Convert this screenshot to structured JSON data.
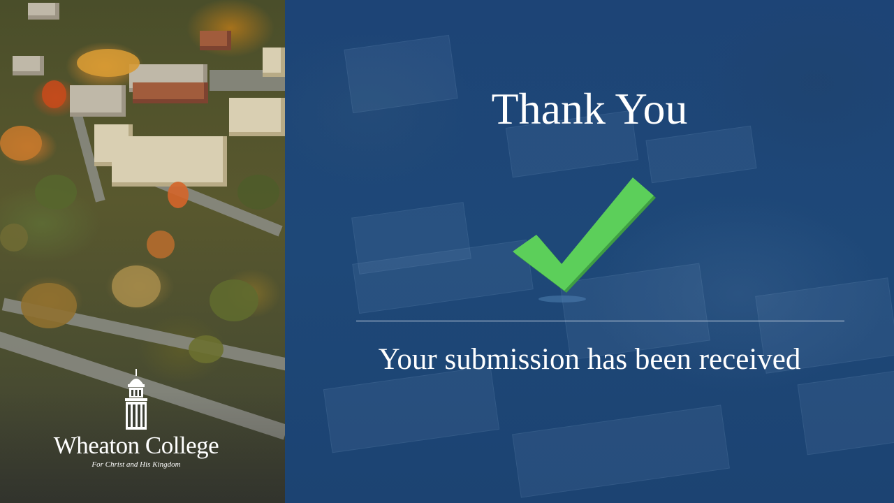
{
  "slide": {
    "title": "Thank You",
    "message": "Your submission has been received"
  },
  "logo": {
    "name": "Wheaton College",
    "tagline": "For Christ and His Kingdom"
  },
  "icons": {
    "checkmark": "checkmark-icon",
    "logo_tower": "bell-tower-icon"
  },
  "colors": {
    "panel_blue": "#1d4476",
    "check_green": "#5ccf5a",
    "text": "#ffffff"
  }
}
